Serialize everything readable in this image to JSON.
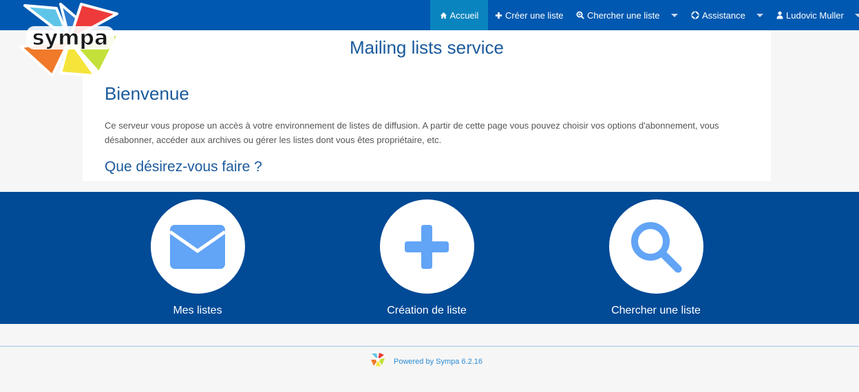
{
  "nav": {
    "home": "Accueil",
    "create": "Créer une liste",
    "search": "Chercher une liste",
    "help": "Assistance",
    "user": "Ludovic Muller"
  },
  "logo": {
    "text": "sympa"
  },
  "main": {
    "service_title": "Mailing lists service",
    "welcome_heading": "Bienvenue",
    "intro": "Ce serveur vous propose un accès à votre environnement de listes de diffusion. A partir de cette page vous pouvez choisir vos options d'abonnement, vous désabonner, accéder aux archives ou gérer les listes dont vous êtes propriétaire, etc.",
    "question_heading": "Que désirez-vous faire ?"
  },
  "actions": [
    {
      "label": "Mes listes",
      "icon": "envelope-icon"
    },
    {
      "label": "Création de liste",
      "icon": "plus-icon"
    },
    {
      "label": "Chercher une liste",
      "icon": "search-icon"
    }
  ],
  "footer": {
    "powered": "Powered by Sympa 6.2.16"
  },
  "colors": {
    "navbar": "#0058b0",
    "active_tab": "#0a84bf",
    "band": "#004a96",
    "heading": "#1b5a9c",
    "icon": "#62a4f6",
    "link": "#2b8bd6"
  }
}
